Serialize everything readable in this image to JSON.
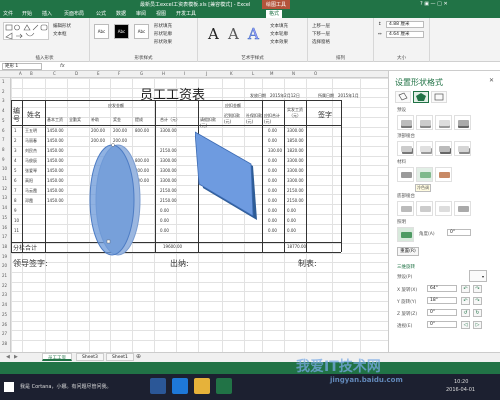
{
  "window": {
    "title": "最新员工excel工资表模板.xls [兼容模式] - Excel",
    "drawing_tools_label": "绘图工具",
    "controls": "? ▣ — □ ✕"
  },
  "ribbon_tabs": [
    "文件",
    "开始",
    "插入",
    "页面布局",
    "公式",
    "数据",
    "审阅",
    "视图",
    "开发工具",
    "格式"
  ],
  "ribbon": {
    "groups": [
      "插入形状",
      "形状样式",
      "艺术字样式",
      "排列",
      "大小"
    ],
    "edit_shape": "编辑形状",
    "text_box": "文本框",
    "align_text": "对齐文本",
    "fill": "形状填充",
    "outline": "形状轮廓",
    "effects": "形状效果",
    "text_fill": "文本填充",
    "text_outline": "文本轮廓",
    "text_effects": "文本效果",
    "bring_forward": "上移一层",
    "send_backward": "下移一层",
    "selection_pane": "选择窗格",
    "height": "4.88 厘米",
    "width": "4.64 厘米",
    "style_swatches": [
      "Abc",
      "Abc",
      "Abc"
    ]
  },
  "formula_bar": {
    "name_box": "矩形 1",
    "fx": "fx"
  },
  "columns": [
    "A",
    "B",
    "C",
    "D",
    "E",
    "F",
    "G",
    "H",
    "I",
    "J",
    "K",
    "L",
    "M",
    "N",
    "O"
  ],
  "rows": [
    "1",
    "2",
    "3",
    "4",
    "5",
    "6",
    "7",
    "8",
    "9",
    "10",
    "11",
    "12",
    "13",
    "14",
    "15",
    "16",
    "17",
    "18",
    "19",
    "20",
    "21",
    "22",
    "23",
    "24",
    "25",
    "26",
    "27",
    "28"
  ],
  "sheet": {
    "title": "员工工资表",
    "pay_date_label": "发放日期",
    "pay_date": "2015年2月12日",
    "period": "所属日期",
    "period_value": "2015年1月",
    "h_no": "编号",
    "h_name": "姓名",
    "h_should": "应发金额",
    "h_deduct": "应扣金额",
    "h_actual": "实发工资（元）",
    "h_sign": "签字",
    "sub_should": [
      "基本工资",
      "全勤奖",
      "补助",
      "奖金",
      "提成",
      "合计（元）"
    ],
    "sub_deduct": [
      "请假扣款(元)",
      "迟到扣款(元)",
      "社保扣款(元)",
      "应扣合计(元)"
    ],
    "rows": [
      {
        "no": "1",
        "name": "王五明",
        "v": [
          "1450.00",
          "",
          "200.00",
          "200.00",
          "800.00",
          "3300.00",
          "",
          "",
          "0.00",
          "3300.00"
        ]
      },
      {
        "no": "2",
        "name": "马丽春",
        "v": [
          "1450.00",
          "",
          "200.00",
          "200.00",
          "",
          "",
          "",
          "",
          "0.00",
          "1850.00"
        ]
      },
      {
        "no": "3",
        "name": "刘民杰",
        "v": [
          "1450.00",
          "",
          "",
          "",
          "",
          "2150.00",
          "",
          "",
          "330.00",
          "1820.00"
        ]
      },
      {
        "no": "4",
        "name": "马俊辰",
        "v": [
          "1450.00",
          "",
          "",
          "",
          "800.00",
          "3300.00",
          "",
          "",
          "0.00",
          "3300.00"
        ]
      },
      {
        "no": "5",
        "name": "张爱琴",
        "v": [
          "1450.00",
          "",
          "",
          "",
          "800.00",
          "3300.00",
          "",
          "",
          "0.00",
          "3300.00"
        ]
      },
      {
        "no": "6",
        "name": "高阳",
        "v": [
          "1450.00",
          "",
          "",
          "",
          "800.00",
          "3300.00",
          "",
          "",
          "0.00",
          "3300.00"
        ]
      },
      {
        "no": "7",
        "name": "马云霞",
        "v": [
          "1450.00",
          "",
          "",
          "",
          "",
          "2150.00",
          "",
          "",
          "0.00",
          "2150.00"
        ]
      },
      {
        "no": "8",
        "name": "邓霞",
        "v": [
          "1450.00",
          "",
          "",
          "",
          "",
          "2150.00",
          "",
          "",
          "0.00",
          "2150.00"
        ]
      },
      {
        "no": "9",
        "name": "",
        "v": [
          "",
          "",
          "",
          "",
          "",
          "0.00",
          "",
          "",
          "0.00",
          "0.00"
        ]
      },
      {
        "no": "10",
        "name": "",
        "v": [
          "",
          "",
          "",
          "",
          "",
          "0.00",
          "",
          "",
          "0.00",
          "0.00"
        ]
      },
      {
        "no": "11",
        "name": "",
        "v": [
          "",
          "",
          "",
          "",
          "",
          "0.00",
          "",
          "",
          "0.00",
          "0.00"
        ]
      }
    ],
    "subtotal_label": "分栏合计",
    "subtotal_should": "19600.00",
    "subtotal_actual": "18770.00",
    "leader_sign": "领导签字:",
    "cashier": "出纳:",
    "maker": "制表:"
  },
  "pane": {
    "title": "设置形状格式",
    "close": "✕",
    "sec_preset": "预设",
    "sec_top": "顶部棱台",
    "sec_bottom": "底部棱台",
    "sec_material": "材料",
    "sec_light": "照明",
    "hover_label": "冷色调",
    "angle_label": "角度(A)",
    "angle": "0°",
    "reset": "重置(R)",
    "rotation_title": "三维旋转",
    "preset_label": "预设(P)",
    "x_label": "X 旋转(X)",
    "x_val": "64°",
    "y_label": "Y 旋转(Y)",
    "y_val": "18°",
    "z_label": "Z 旋转(Z)",
    "z_val": "0°",
    "persp_label": "透视(E)",
    "persp_val": "0°"
  },
  "sheet_tabs": [
    "员工工资",
    "Sheet3",
    "Sheet1"
  ],
  "taskbar": {
    "search": "我是 Cortana，小娜。有问题尽管问我。",
    "time": "10:20",
    "date": "2016-04-01"
  },
  "watermark": {
    "text": "我爱IT技术网",
    "url": "jingyan.baidu.com"
  },
  "colors": {
    "excel_green": "#217346",
    "shape_blue": "#5a8fd6",
    "shape_edge": "#2e6fbf"
  }
}
